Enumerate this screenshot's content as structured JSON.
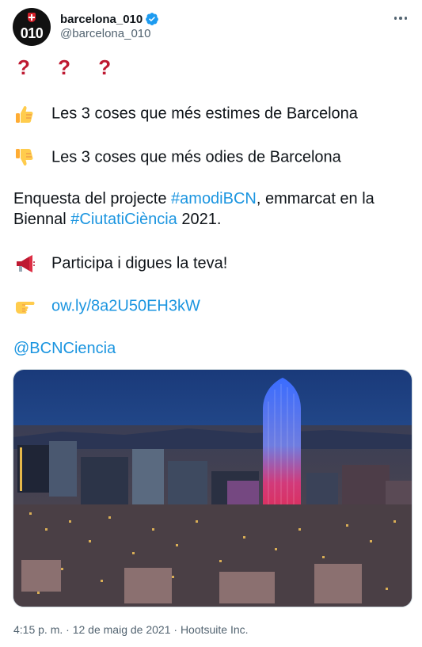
{
  "account": {
    "avatar_text": "010",
    "display_name": "barcelona_010",
    "handle": "@barcelona_010"
  },
  "tweet": {
    "question_marks": "? ? ?",
    "line_likes": "Les 3 coses que més estimes de Barcelona",
    "line_dislikes": "Les 3 coses que més odies de Barcelona",
    "enquesta_prefix": "Enquesta del projecte ",
    "hashtag_amodi": "#amodiBCN",
    "enquesta_mid": ", emmarcat en la",
    "biennal_prefix": "Biennal ",
    "hashtag_ciutat": "#CiutatiCiència",
    "biennal_suffix": " 2021.",
    "participa": "Participa i digues la teva!",
    "link": "ow.ly/8a2U50EH3kW",
    "mention": "@BCNCiencia"
  },
  "media": {
    "icon": "photo-barcelona-skyline-torre-agbar"
  },
  "footer": {
    "time": "4:15 p. m.",
    "separator1": " · ",
    "date": "12 de maig de 2021",
    "separator2": " · ",
    "source": "Hootsuite Inc."
  },
  "icons": {
    "verified": "verified-badge-icon",
    "more": "more-options-icon",
    "thumbs_up": "thumbs-up-icon",
    "thumbs_down": "thumbs-down-icon",
    "megaphone": "megaphone-icon",
    "pointing": "backhand-index-pointing-right-icon"
  },
  "colors": {
    "link": "#1b95e0",
    "question_mark": "#be1931",
    "text": "#0f1419",
    "secondary": "#536471"
  }
}
